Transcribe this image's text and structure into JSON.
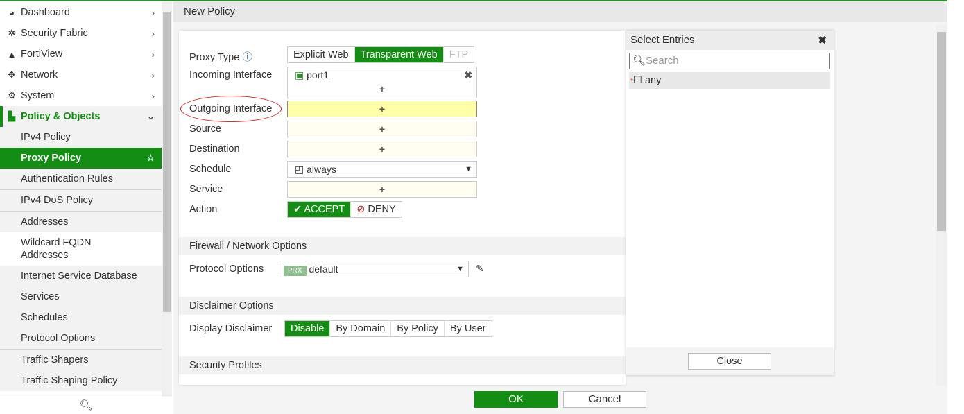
{
  "sidebar": {
    "items": [
      {
        "label": "Dashboard",
        "icon": "dashboard-icon"
      },
      {
        "label": "Security Fabric",
        "icon": "fabric-icon"
      },
      {
        "label": "FortiView",
        "icon": "chart-icon"
      },
      {
        "label": "Network",
        "icon": "move-icon"
      },
      {
        "label": "System",
        "icon": "gear-icon"
      },
      {
        "label": "Policy & Objects",
        "icon": "policy-icon"
      }
    ],
    "sub": [
      "IPv4 Policy",
      "Proxy Policy",
      "Authentication Rules",
      "IPv4 DoS Policy",
      "Addresses",
      "Wildcard FQDN Addresses",
      "Internet Service Database",
      "Services",
      "Schedules",
      "Protocol Options",
      "Traffic Shapers",
      "Traffic Shaping Policy"
    ]
  },
  "header": {
    "title": "New Policy"
  },
  "form": {
    "proxy_type_label": "Proxy Type",
    "proxy_types": [
      "Explicit Web",
      "Transparent Web",
      "FTP"
    ],
    "incoming_label": "Incoming Interface",
    "incoming_value": "port1",
    "outgoing_label": "Outgoing Interface",
    "source_label": "Source",
    "destination_label": "Destination",
    "schedule_label": "Schedule",
    "schedule_value": "always",
    "service_label": "Service",
    "action_label": "Action",
    "accept": "ACCEPT",
    "deny": "DENY",
    "plus": "+",
    "fw_section": "Firewall / Network Options",
    "protocol_label": "Protocol Options",
    "protocol_badge": "PRX",
    "protocol_value": "default",
    "disclaimer_section": "Disclaimer Options",
    "disclaimer_label": "Display Disclaimer",
    "disclaimer_opts": [
      "Disable",
      "By Domain",
      "By Policy",
      "By User"
    ],
    "security_section": "Security Profiles"
  },
  "panel": {
    "title": "Select Entries",
    "search_placeholder": "Search",
    "entry": "any",
    "close": "Close"
  },
  "footer": {
    "ok": "OK",
    "cancel": "Cancel"
  }
}
